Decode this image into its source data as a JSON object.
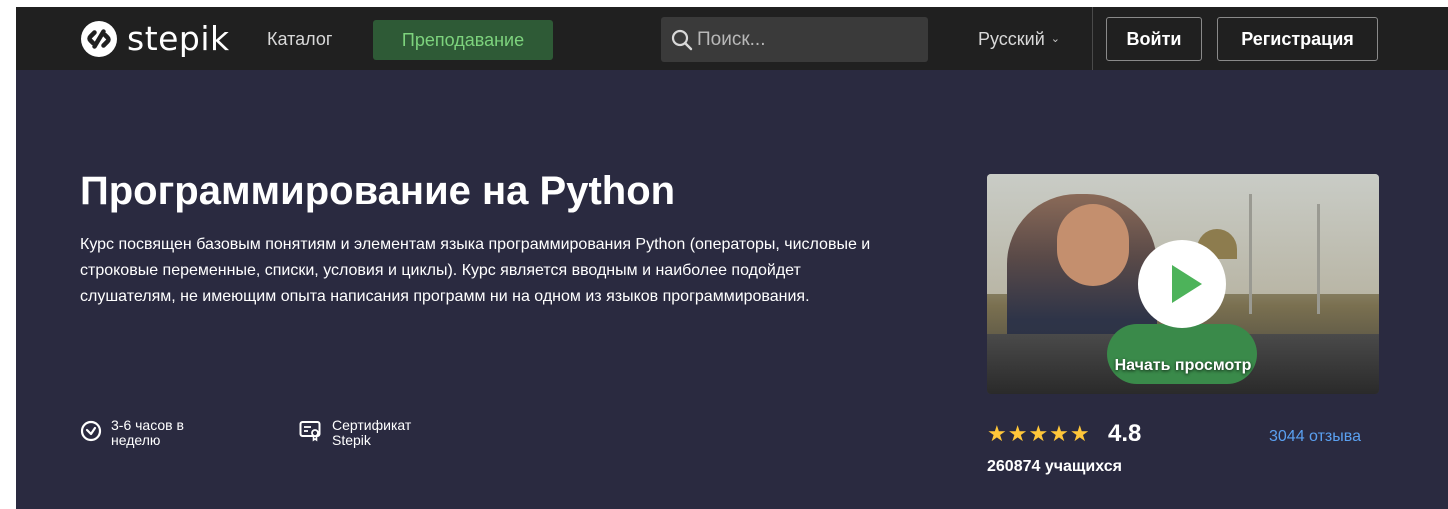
{
  "header": {
    "logo_text": "stepik",
    "nav_catalog": "Каталог",
    "nav_teaching": "Преподавание",
    "search_placeholder": "Поиск...",
    "language": "Русский",
    "login_label": "Войти",
    "register_label": "Регистрация"
  },
  "course": {
    "title": "Программирование на Python",
    "description": "Курс посвящен базовым понятиям и элементам языка программирования Python (операторы, числовые и строковые переменные, списки, условия и циклы). Курс является вводным и наиболее подойдет слушателям, не имеющим опыта написания программ ни на одном из языков программирования.",
    "hours_line1": "3-6 часов в",
    "hours_line2": "неделю",
    "cert_line1": "Сертификат",
    "cert_line2": "Stepik",
    "video_label": "Начать просмотр",
    "stars": "★★★★★",
    "rating": "4.8",
    "reviews": "3044 отзыва",
    "learners": "260874 учащихся"
  },
  "colors": {
    "header_bg": "#202020",
    "hero_bg": "#2a2a40",
    "teach_bg": "#2e5a36",
    "teach_text": "#7dd37d",
    "star": "#ffc73a",
    "link": "#5aa0f0",
    "play": "#4db35a"
  },
  "icons": {
    "logo": "stepik-logo-icon",
    "search": "search-icon",
    "language": "chevron-down-icon",
    "hours": "clock-icon",
    "certificate": "certificate-icon",
    "play": "play-icon"
  }
}
